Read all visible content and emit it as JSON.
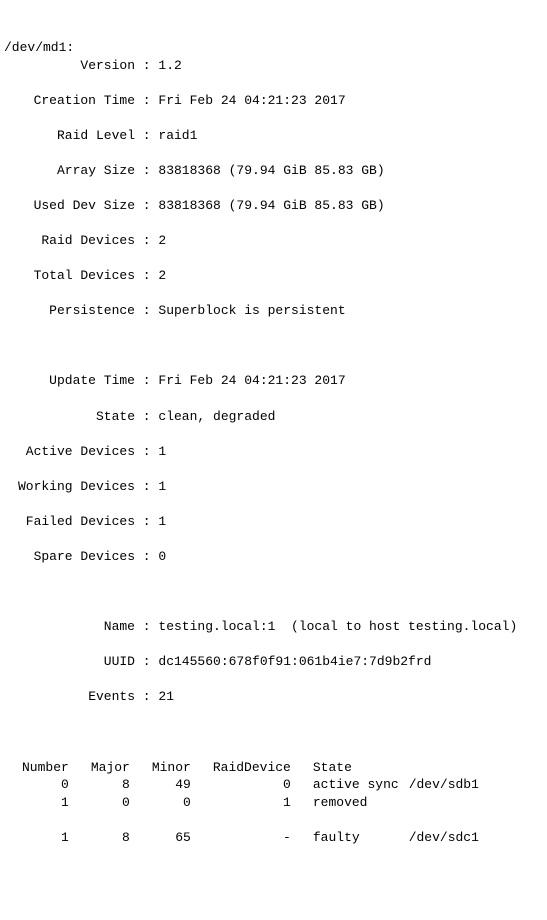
{
  "header": "/dev/md1:",
  "rows": [
    {
      "label": "Version",
      "value": "1.2"
    },
    {
      "label": "Creation Time",
      "value": "Fri Feb 24 04:21:23 2017"
    },
    {
      "label": "Raid Level",
      "value": "raid1"
    },
    {
      "label": "Array Size",
      "value": "83818368 (79.94 GiB 85.83 GB)"
    },
    {
      "label": "Used Dev Size",
      "value": "83818368 (79.94 GiB 85.83 GB)"
    },
    {
      "label": "Raid Devices",
      "value": "2"
    },
    {
      "label": "Total Devices",
      "value": "2"
    },
    {
      "label": "Persistence",
      "value": "Superblock is persistent"
    },
    {
      "label": "",
      "value": ""
    },
    {
      "label": "Update Time",
      "value": "Fri Feb 24 04:21:23 2017"
    },
    {
      "label": "State",
      "value": "clean, degraded"
    },
    {
      "label": "Active Devices",
      "value": "1"
    },
    {
      "label": "Working Devices",
      "value": "1"
    },
    {
      "label": "Failed Devices",
      "value": "1"
    },
    {
      "label": "Spare Devices",
      "value": "0"
    },
    {
      "label": "",
      "value": ""
    },
    {
      "label": "Name",
      "value": "testing.local:1  (local to host testing.local)"
    },
    {
      "label": "UUID",
      "value": "dc145560:678f0f91:061b4ie7:7d9b2frd"
    },
    {
      "label": "Events",
      "value": "21"
    }
  ],
  "devtable": {
    "headers": [
      "Number",
      "Major",
      "Minor",
      "RaidDevice",
      "State",
      ""
    ],
    "rows": [
      [
        "0",
        "8",
        "49",
        "0",
        "active sync",
        "/dev/sdb1"
      ],
      [
        "1",
        "0",
        "0",
        "1",
        "removed",
        ""
      ],
      [
        "",
        "",
        "",
        "",
        "",
        ""
      ],
      [
        "1",
        "8",
        "65",
        "-",
        "faulty",
        "/dev/sdc1"
      ]
    ]
  }
}
